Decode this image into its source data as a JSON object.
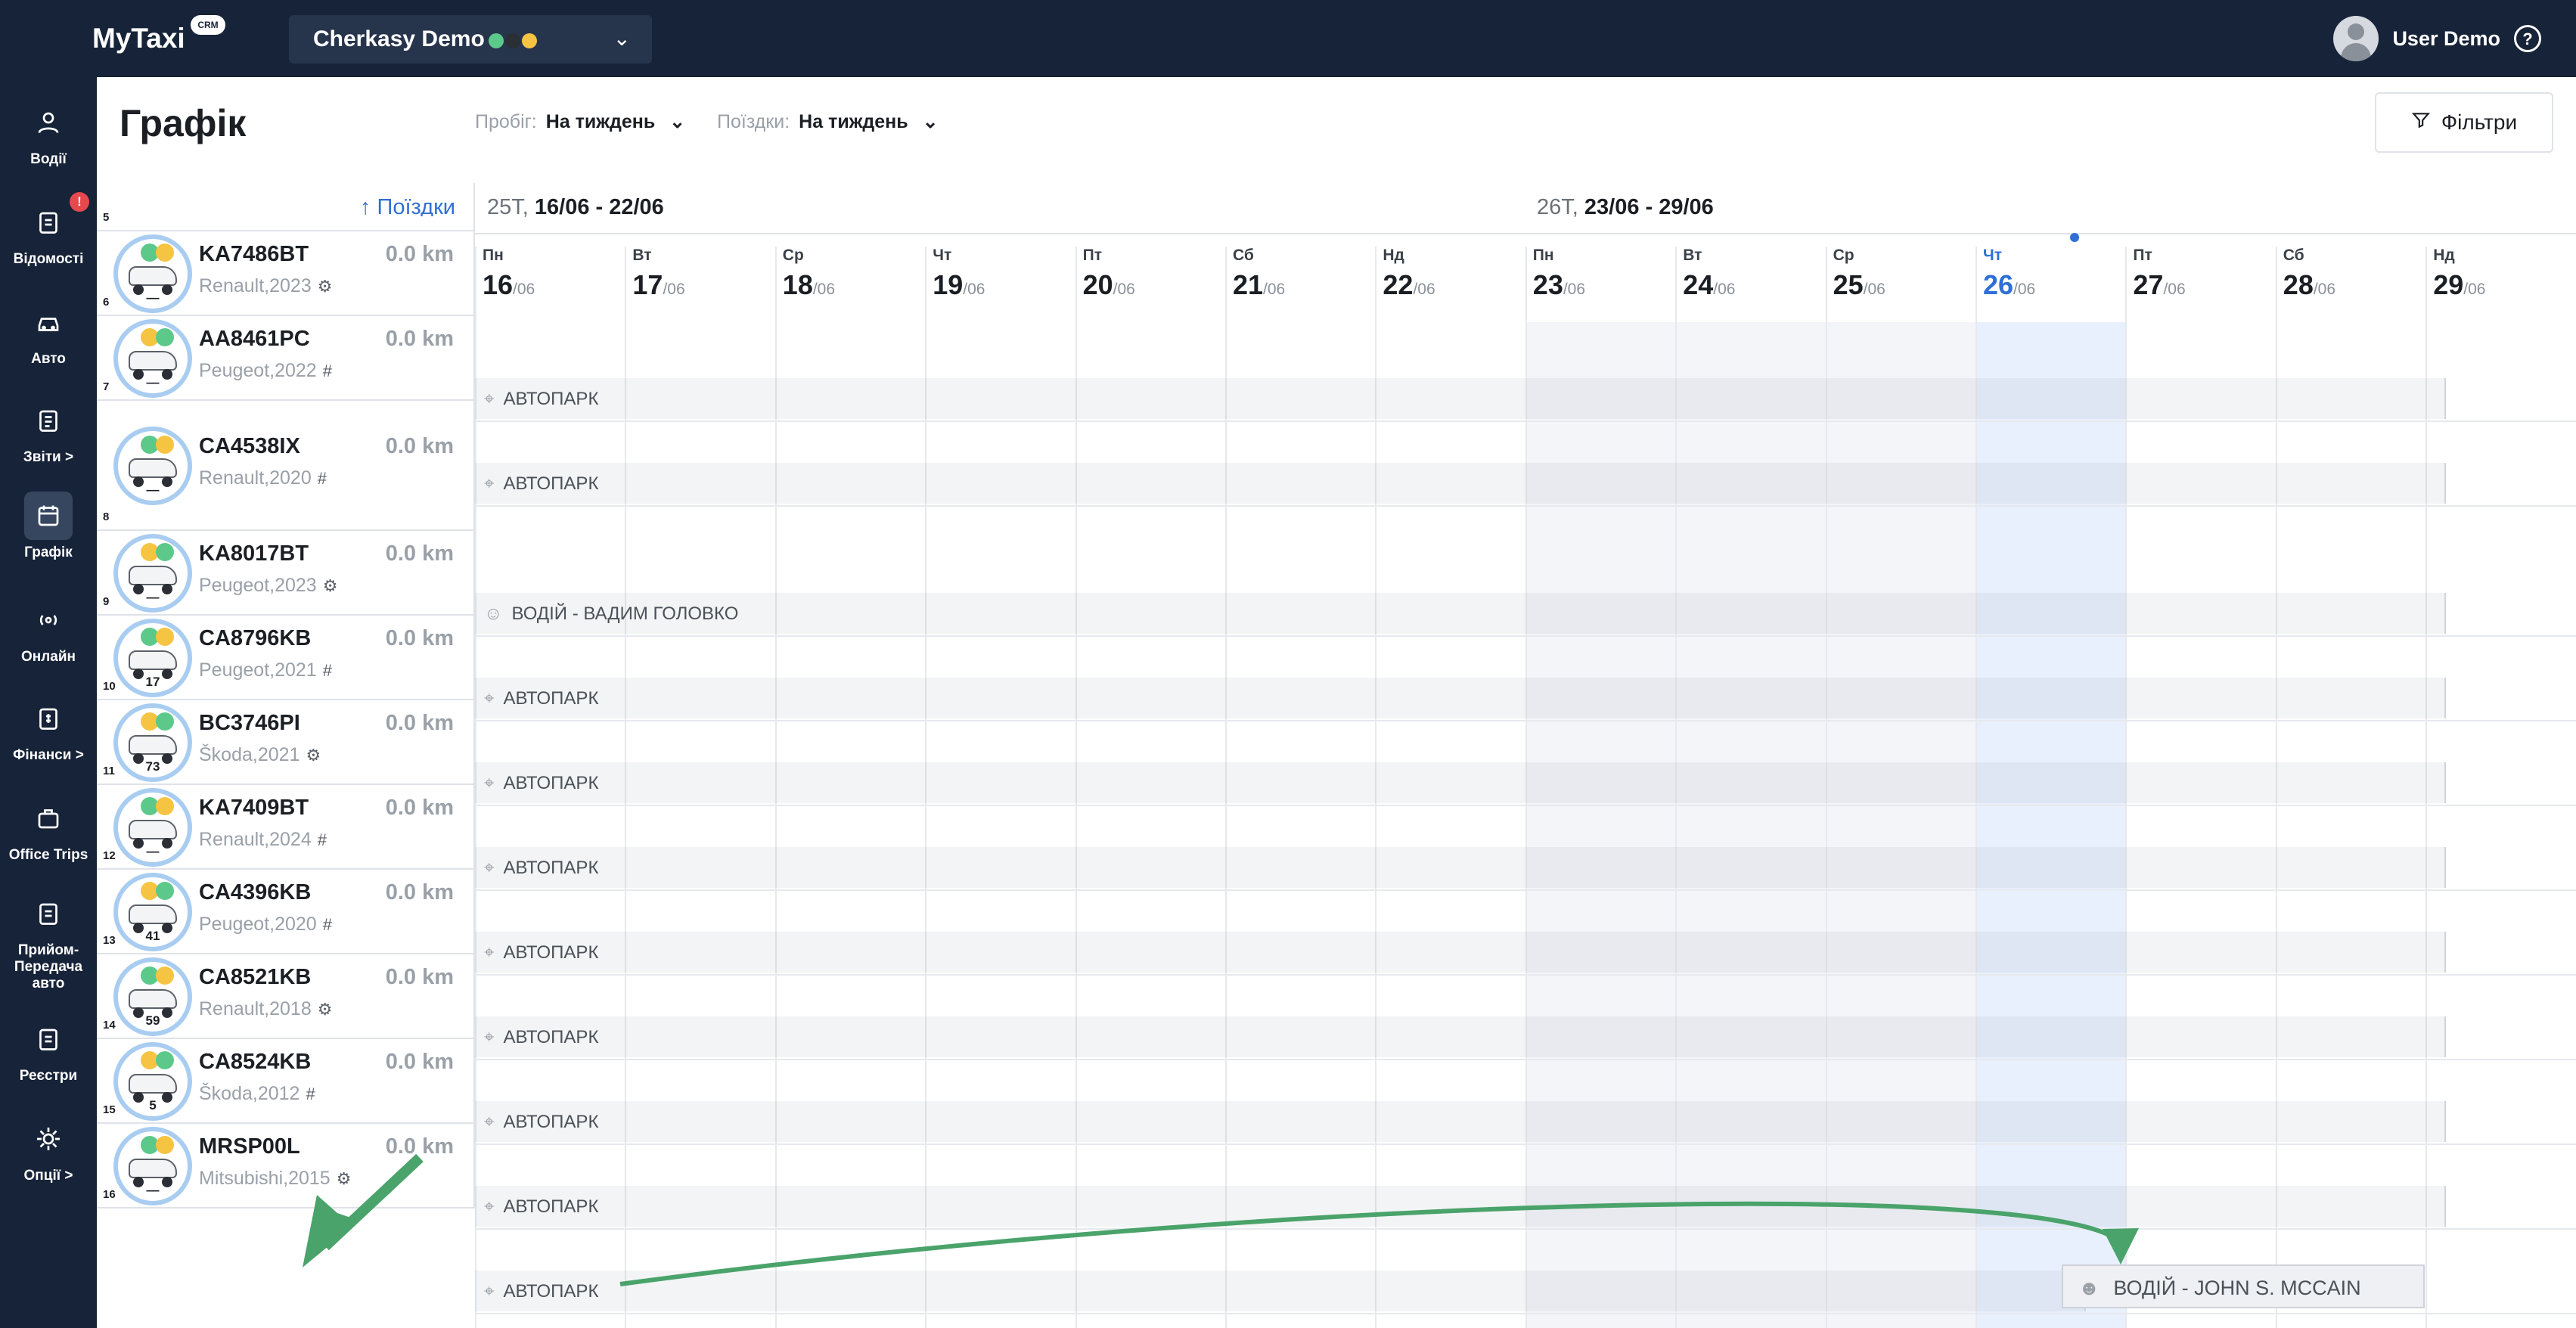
{
  "app": {
    "logo": "MyTaxi",
    "crm": "CRM",
    "org": "Cherkasy Demo",
    "user": "User Demo",
    "help": "?"
  },
  "sidebar": [
    {
      "label": "Водії",
      "icon": "driver-icon"
    },
    {
      "label": "Відомості",
      "icon": "statements-icon",
      "badge": "!"
    },
    {
      "label": "Авто",
      "icon": "car-icon"
    },
    {
      "label": "Звіти >",
      "icon": "reports-icon"
    },
    {
      "label": "Графік",
      "icon": "calendar-icon",
      "active": true
    },
    {
      "label": "Онлайн",
      "icon": "online-icon"
    },
    {
      "label": "Фінанси >",
      "icon": "finance-icon"
    },
    {
      "label": "Office Trips",
      "icon": "briefcase-icon"
    },
    {
      "label": "Прийом-Передача авто",
      "icon": "handover-icon"
    },
    {
      "label": "Реєстри",
      "icon": "registry-icon"
    },
    {
      "label": "Опції >",
      "icon": "gear-icon"
    }
  ],
  "page": {
    "title": "Графік",
    "mileage_label": "Пробіг:",
    "mileage_value": "На тиждень",
    "trips_label": "Поїздки:",
    "trips_value": "На тиждень",
    "filters": "Фільтри",
    "trips_link": "↑ Поїздки"
  },
  "weeks": [
    {
      "num": "25Т,",
      "range": "16/06 - 22/06"
    },
    {
      "num": "26Т,",
      "range": "23/06 - 29/06"
    }
  ],
  "days": [
    {
      "wd": "Пн",
      "d": "16",
      "m": "/06"
    },
    {
      "wd": "Вт",
      "d": "17",
      "m": "/06"
    },
    {
      "wd": "Ср",
      "d": "18",
      "m": "/06"
    },
    {
      "wd": "Чт",
      "d": "19",
      "m": "/06"
    },
    {
      "wd": "Пт",
      "d": "20",
      "m": "/06"
    },
    {
      "wd": "Сб",
      "d": "21",
      "m": "/06"
    },
    {
      "wd": "Нд",
      "d": "22",
      "m": "/06"
    },
    {
      "wd": "Пн",
      "d": "23",
      "m": "/06"
    },
    {
      "wd": "Вт",
      "d": "24",
      "m": "/06"
    },
    {
      "wd": "Ср",
      "d": "25",
      "m": "/06"
    },
    {
      "wd": "Чт",
      "d": "26",
      "m": "/06",
      "today": true
    },
    {
      "wd": "Пт",
      "d": "27",
      "m": "/06"
    },
    {
      "wd": "Сб",
      "d": "28",
      "m": "/06"
    },
    {
      "wd": "Нд",
      "d": "29",
      "m": "/06"
    }
  ],
  "vehicles": [
    {
      "idx": "6",
      "plate": "KA7486BT",
      "model": "Renault,2023",
      "trans": "auto",
      "km": "0.0 km",
      "num": "—",
      "band": "АВТОПАРК",
      "band_icon": "pin"
    },
    {
      "idx": "7",
      "plate": "AA8461PC",
      "model": "Peugeot,2022",
      "trans": "manual",
      "km": "0.0 km",
      "num": "—",
      "band": "АВТОПАРК",
      "band_icon": "pin"
    },
    {
      "idx": "8",
      "plate": "CA4538IX",
      "model": "Renault,2020",
      "trans": "manual",
      "km": "0.0 km",
      "num": "—",
      "band": "ВОДІЙ - ВАДИМ ГОЛОВКО",
      "band_icon": "person"
    },
    {
      "idx": "9",
      "plate": "KA8017BT",
      "model": "Peugeot,2023",
      "trans": "auto",
      "km": "0.0 km",
      "num": "—",
      "band": "АВТОПАРК",
      "band_icon": "pin"
    },
    {
      "idx": "10",
      "plate": "CA8796KB",
      "model": "Peugeot,2021",
      "trans": "manual",
      "km": "0.0 km",
      "num": "17",
      "band": "АВТОПАРК",
      "band_icon": "pin"
    },
    {
      "idx": "11",
      "plate": "BC3746PI",
      "model": "Škoda,2021",
      "trans": "auto",
      "km": "0.0 km",
      "num": "73",
      "band": "АВТОПАРК",
      "band_icon": "pin"
    },
    {
      "idx": "12",
      "plate": "KA7409BT",
      "model": "Renault,2024",
      "trans": "manual",
      "km": "0.0 km",
      "num": "—",
      "band": "АВТОПАРК",
      "band_icon": "pin"
    },
    {
      "idx": "13",
      "plate": "CA4396KB",
      "model": "Peugeot,2020",
      "trans": "manual",
      "km": "0.0 km",
      "num": "41",
      "band": "АВТОПАРК",
      "band_icon": "pin"
    },
    {
      "idx": "14",
      "plate": "CA8521KB",
      "model": "Renault,2018",
      "trans": "auto",
      "km": "0.0 km",
      "num": "59",
      "band": "АВТОПАРК",
      "band_icon": "pin"
    },
    {
      "idx": "15",
      "plate": "CA8524KB",
      "model": "Škoda,2012",
      "trans": "manual",
      "km": "0.0 km",
      "num": "5",
      "band": "АВТОПАРК",
      "band_icon": "pin"
    },
    {
      "idx": "16",
      "plate": "MRSP00L",
      "model": "Mitsubishi,2015",
      "trans": "auto",
      "km": "0.0 km",
      "num": "—",
      "band": "АВТОПАРК",
      "band_icon": "pin"
    }
  ],
  "partial_row_idx": "5",
  "annotation": {
    "text": "ВОДІЙ - JOHN S. MCCAIN",
    "color": "#4aa36a"
  },
  "colors": {
    "nav_bg": "#172338",
    "accent": "#2f6fd6",
    "badge": "#e5484d",
    "green": "#5cc98a",
    "yellow": "#f5c443"
  }
}
